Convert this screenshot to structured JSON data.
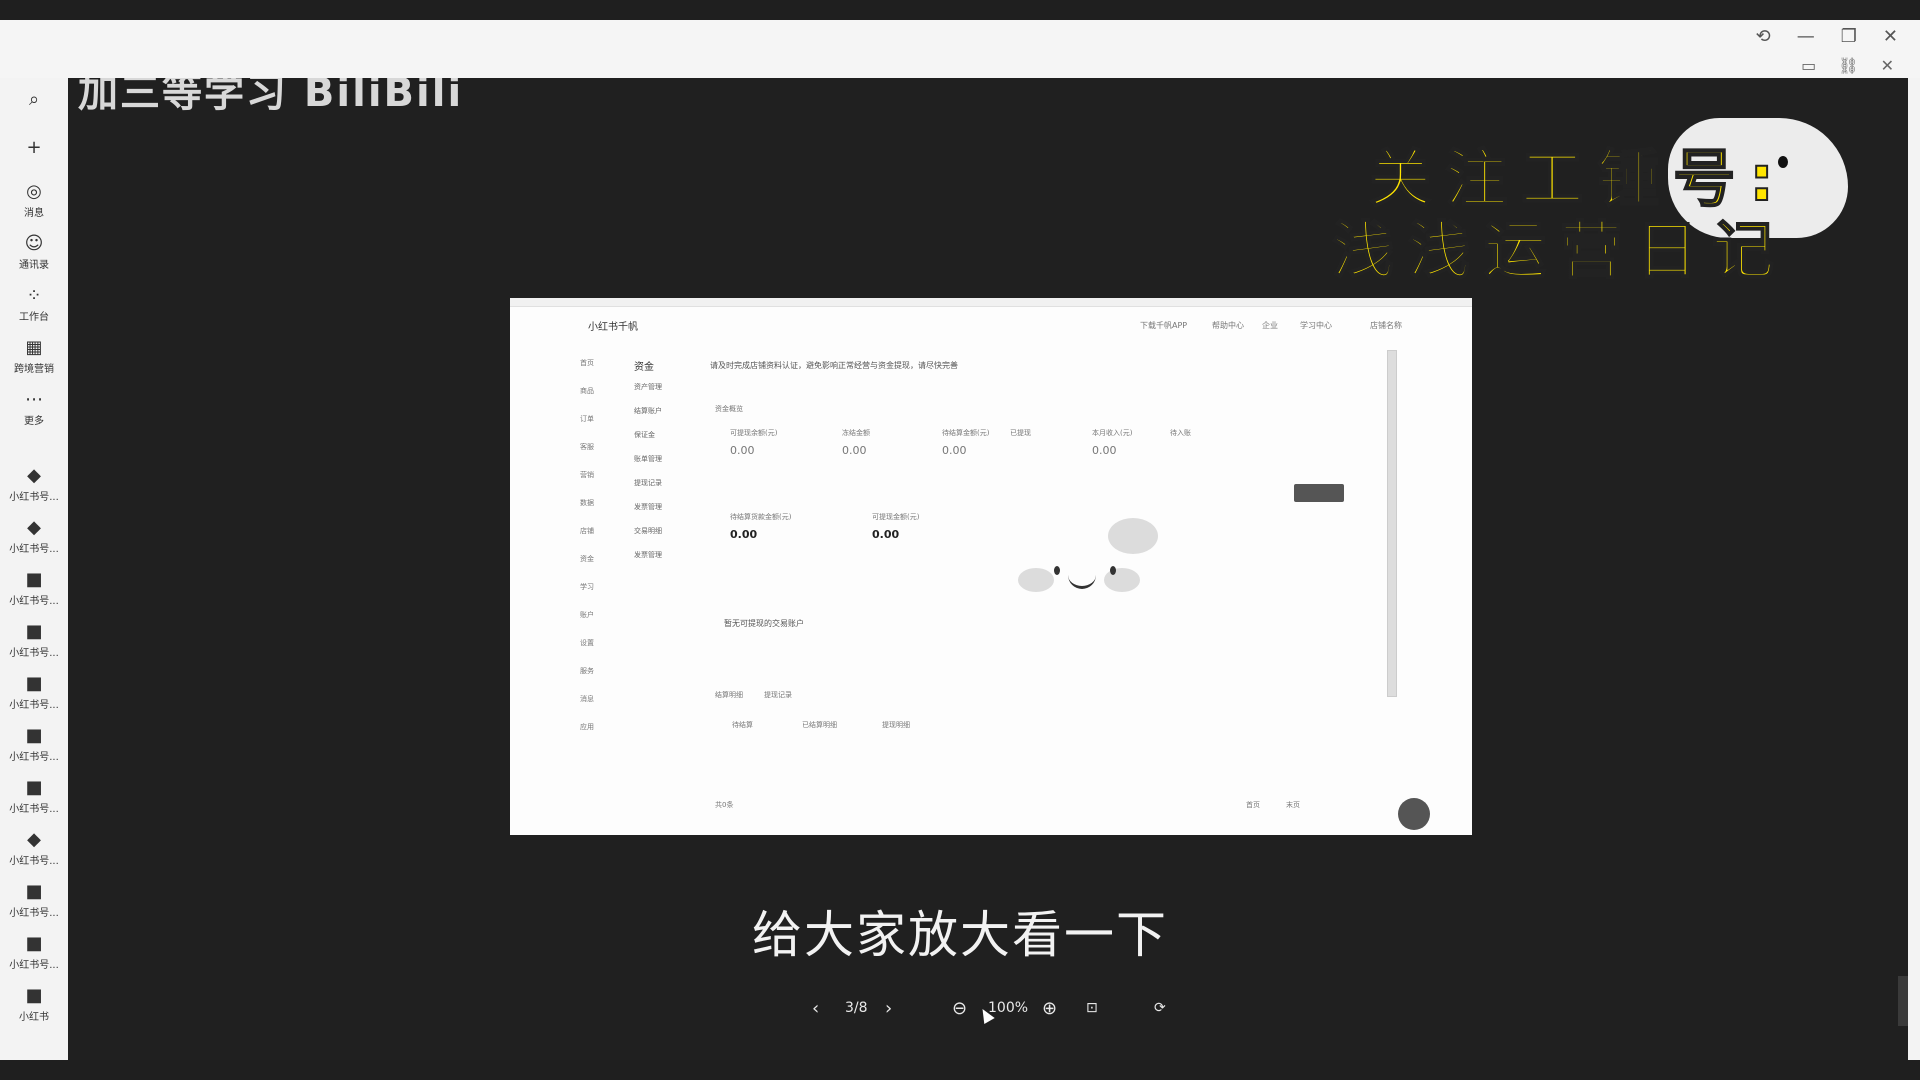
{
  "watermark": "加三等学习 BiliBili",
  "promo": {
    "line1": "关注工锺号:",
    "line2": "浅浅运营日记"
  },
  "sidebar": {
    "items": [
      {
        "icon": "search-icon",
        "label": ""
      },
      {
        "icon": "plus-icon",
        "label": ""
      },
      {
        "icon": "message-icon",
        "label": "消息"
      },
      {
        "icon": "contacts-icon",
        "label": "通讯录"
      },
      {
        "icon": "workspace-icon",
        "label": "工作台"
      },
      {
        "icon": "calendar-icon",
        "label": "跨境营销"
      },
      {
        "icon": "more-icon",
        "label": "更多"
      },
      {
        "icon": "app-icon",
        "label": "小红书号..."
      },
      {
        "icon": "app-icon",
        "label": "小红书号..."
      },
      {
        "icon": "app-icon",
        "label": "小红书号..."
      },
      {
        "icon": "app-icon",
        "label": "小红书号..."
      },
      {
        "icon": "app-icon",
        "label": "小红书号..."
      },
      {
        "icon": "app-icon",
        "label": "小红书号..."
      },
      {
        "icon": "app-icon",
        "label": "小红书号..."
      },
      {
        "icon": "app-icon",
        "label": "小红书号..."
      },
      {
        "icon": "app-icon",
        "label": "小红书号..."
      },
      {
        "icon": "app-icon",
        "label": "小红书号..."
      },
      {
        "icon": "app-icon",
        "label": "小红书"
      }
    ]
  },
  "screenshot": {
    "logo": "小红书千帆",
    "header_links": [
      "下载千帆APP",
      "帮助中心",
      "企业",
      "学习中心",
      "店铺名称"
    ],
    "nav": [
      "首页",
      "商品",
      "订单",
      "客服",
      "营销",
      "数据",
      "店铺",
      "资金",
      "学习",
      "账户",
      "设置",
      "服务",
      "消息",
      "应用"
    ],
    "nav2_title": "资金",
    "nav2": [
      "资产管理",
      "结算账户",
      "保证金",
      "账单管理",
      "提现记录",
      "发票管理",
      "交易明细",
      "发票管理"
    ],
    "notice": "请及时完成店铺资料认证，避免影响正常经营与资金提现，请尽快完善",
    "section_title": "资金概览",
    "metric_labels": [
      "可提现余额(元)",
      "冻结金额",
      "待结算金额(元)",
      "已提现",
      "本月收入(元)",
      "待入账"
    ],
    "metric_values": [
      "0.00",
      "0.00",
      "0.00",
      "0.00"
    ],
    "balance_labels": [
      "待结算货款金额(元)",
      "可提现金额(元)"
    ],
    "balance_values": [
      "0.00",
      "0.00"
    ],
    "empty_text": "暂无可提现的交易账户",
    "tabs": [
      "结算明细",
      "提现记录"
    ],
    "sub_tabs": [
      "待结算",
      "已结算明细",
      "提现明细"
    ],
    "footer": [
      "共0条",
      "首页",
      "末页"
    ]
  },
  "caption": "给大家放大看一下",
  "toolbar": {
    "page": "3/8",
    "zoom": "100%"
  }
}
